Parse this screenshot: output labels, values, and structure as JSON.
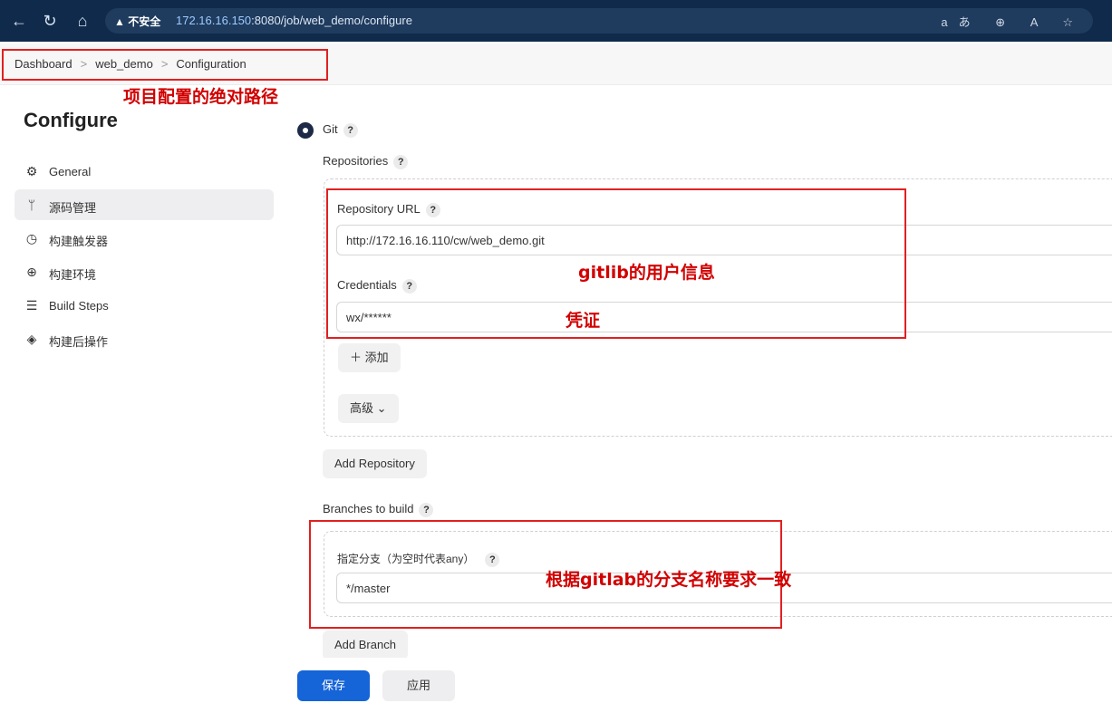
{
  "browser": {
    "warning": "▲ 不安全",
    "url_host": "172.16.16.150",
    "url_path": ":8080/job/web_demo/configure",
    "icons": "aあ ⊕ A ☆"
  },
  "breadcrumb": {
    "items": [
      "Dashboard",
      "web_demo",
      "Configuration"
    ],
    "sep": ">"
  },
  "annotations": {
    "path": "项目配置的绝对路径",
    "user_info": "gitlib的用户信息",
    "credential": "凭证",
    "branch": "根据gitlab的分支名称要求一致"
  },
  "sidebar": {
    "title": "Configure",
    "items": [
      {
        "label": "General",
        "icon": "gear-icon"
      },
      {
        "label": "源码管理",
        "icon": "branch-icon"
      },
      {
        "label": "构建触发器",
        "icon": "clock-icon"
      },
      {
        "label": "构建环境",
        "icon": "globe-icon"
      },
      {
        "label": "Build Steps",
        "icon": "list-icon"
      },
      {
        "label": "构建后操作",
        "icon": "box-icon"
      }
    ]
  },
  "scm": {
    "git_label": "Git",
    "help": "?",
    "repositories_label": "Repositories",
    "repo_url_label": "Repository URL",
    "repo_url_value": "http://172.16.16.110/cw/web_demo.git",
    "credentials_label": "Credentials",
    "credentials_value": "wx/******",
    "add_label": "＋  添加",
    "advanced_label": "高级  ⌄",
    "add_repository": "Add Repository",
    "branches_label": "Branches to build",
    "branch_spec_label": "指定分支（为空时代表any）",
    "branch_spec_value": "*/master",
    "add_branch": "Add Branch"
  },
  "footer": {
    "save": "保存",
    "apply": "应用"
  },
  "colors": {
    "annotation": "#d10000",
    "primary": "#1564d8"
  }
}
